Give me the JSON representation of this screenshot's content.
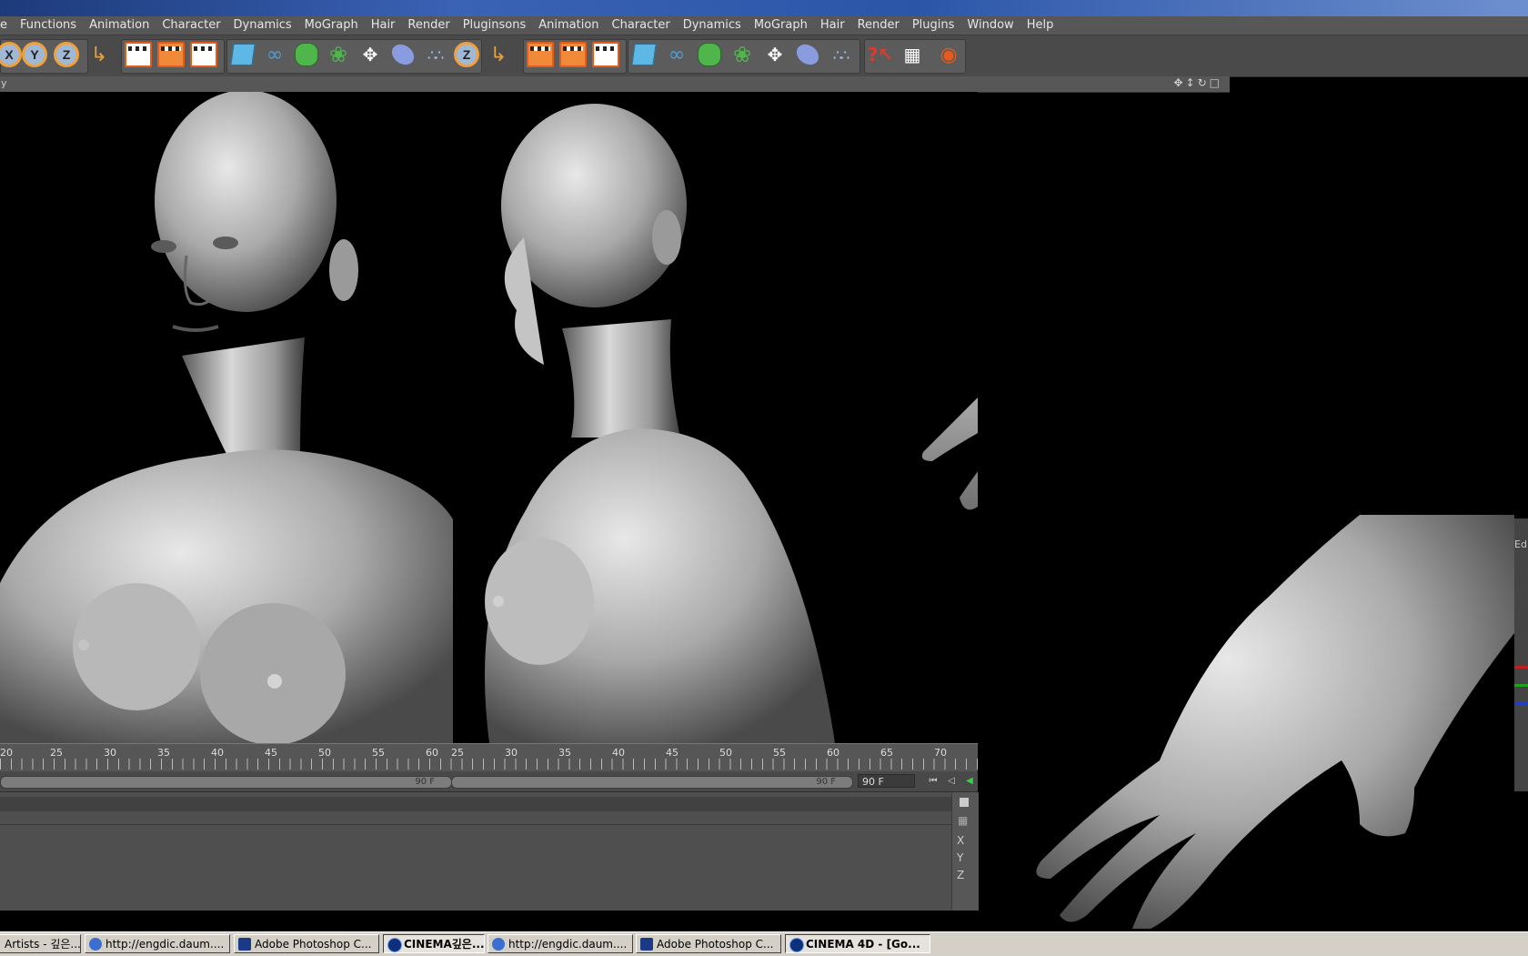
{
  "menubar": {
    "items": [
      "e",
      "Functions",
      "Animation",
      "Character",
      "Dynamics",
      "MoGraph",
      "Hair",
      "Render",
      "Pluginsons",
      "Animation",
      "Character",
      "Dynamics",
      "MoGraph",
      "Hair",
      "Render",
      "Plugins",
      "Window",
      "Help"
    ]
  },
  "toolbar": {
    "axis_labels": [
      "X",
      "Y",
      "Z"
    ],
    "axis_label_z2": "Z",
    "icons": [
      "x-axis-icon",
      "y-axis-icon",
      "z-axis-icon",
      "coordinate-system-icon",
      "render-view-icon",
      "render-picture-viewer-icon",
      "render-settings-icon",
      "cube-primitive-icon",
      "spline-icon",
      "nurbs-icon",
      "array-icon",
      "deformer-icon",
      "scene-object-icon",
      "particle-icon",
      "help-icon",
      "layout-icon",
      "web-icon"
    ]
  },
  "viewport": {
    "header_left": "y",
    "nav_icons": [
      "move-view-icon",
      "zoom-view-icon",
      "rotate-view-icon",
      "maximize-view-icon"
    ]
  },
  "timeline": {
    "ticks_left": [
      "20",
      "25",
      "30",
      "35",
      "40",
      "45",
      "50",
      "55",
      "60"
    ],
    "ticks_right": [
      "25",
      "30",
      "35",
      "40",
      "45",
      "50",
      "55",
      "60",
      "65",
      "70"
    ],
    "track_left_label": "90 F",
    "track_right_label": "90 F",
    "frame_field": "90 F"
  },
  "attributes": {
    "coords": [
      "X",
      "Y",
      "Z"
    ]
  },
  "right_panel": {
    "label": "Ed"
  },
  "taskbar": {
    "items": [
      {
        "label": "Artists - 깊은...",
        "icon": "none"
      },
      {
        "label": "http://engdic.daum....",
        "icon": "ie"
      },
      {
        "label": "Adobe Photoshop C...",
        "icon": "ps"
      },
      {
        "label": "CINEMA깊은...",
        "icon": "c4d",
        "active": true
      },
      {
        "label": "http://engdic.daum....",
        "icon": "ie"
      },
      {
        "label": "Adobe Photoshop C...",
        "icon": "ps"
      },
      {
        "label": "CINEMA 4D - [Go...",
        "icon": "c4d",
        "active": true
      }
    ]
  }
}
